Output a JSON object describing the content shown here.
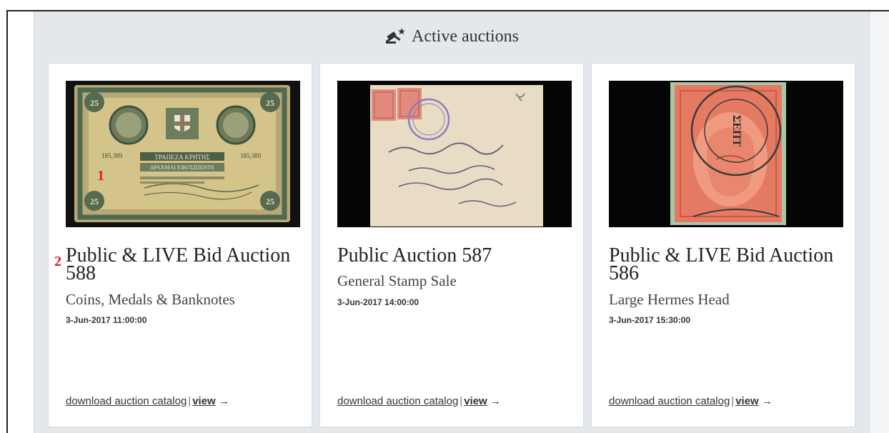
{
  "section": {
    "title": "Active auctions",
    "icon": "gavel-icon"
  },
  "cards": [
    {
      "title": "Public & LIVE Bid Auction 588",
      "subtitle": "Coins, Medals & Banknotes",
      "date": "3-Jun-2017 11:00:00",
      "download_label": "download auction catalog",
      "separator": "|",
      "view_label": "view",
      "arrow": "→",
      "image": "banknote-image",
      "banknote_text": "ΤΡΑΠΕΖΑ ΚΡΗΤΗΣ",
      "banknote_value": "ΔΡΑΧΜΑΙ ΕΙΚΟΣΙΠΕΝΤΕ",
      "banknote_denom": "25",
      "banknote_serial": "185,389"
    },
    {
      "title": "Public Auction 587",
      "subtitle": "General Stamp Sale",
      "date": "3-Jun-2017 14:00:00",
      "download_label": "download auction catalog",
      "separator": "|",
      "view_label": "view",
      "arrow": "→",
      "image": "envelope-image"
    },
    {
      "title": "Public & LIVE Bid Auction 586",
      "subtitle": "Large Hermes Head",
      "date": "3-Jun-2017 15:30:00",
      "download_label": "download auction catalog",
      "separator": "|",
      "view_label": "view",
      "arrow": "→",
      "image": "stamp-image",
      "postmark_text": "ΣΕΠΤ"
    }
  ],
  "annotations": [
    "1",
    "2"
  ],
  "colors": {
    "panel": "#e4e8ec",
    "card": "#ffffff",
    "annotation": "#e02020"
  }
}
